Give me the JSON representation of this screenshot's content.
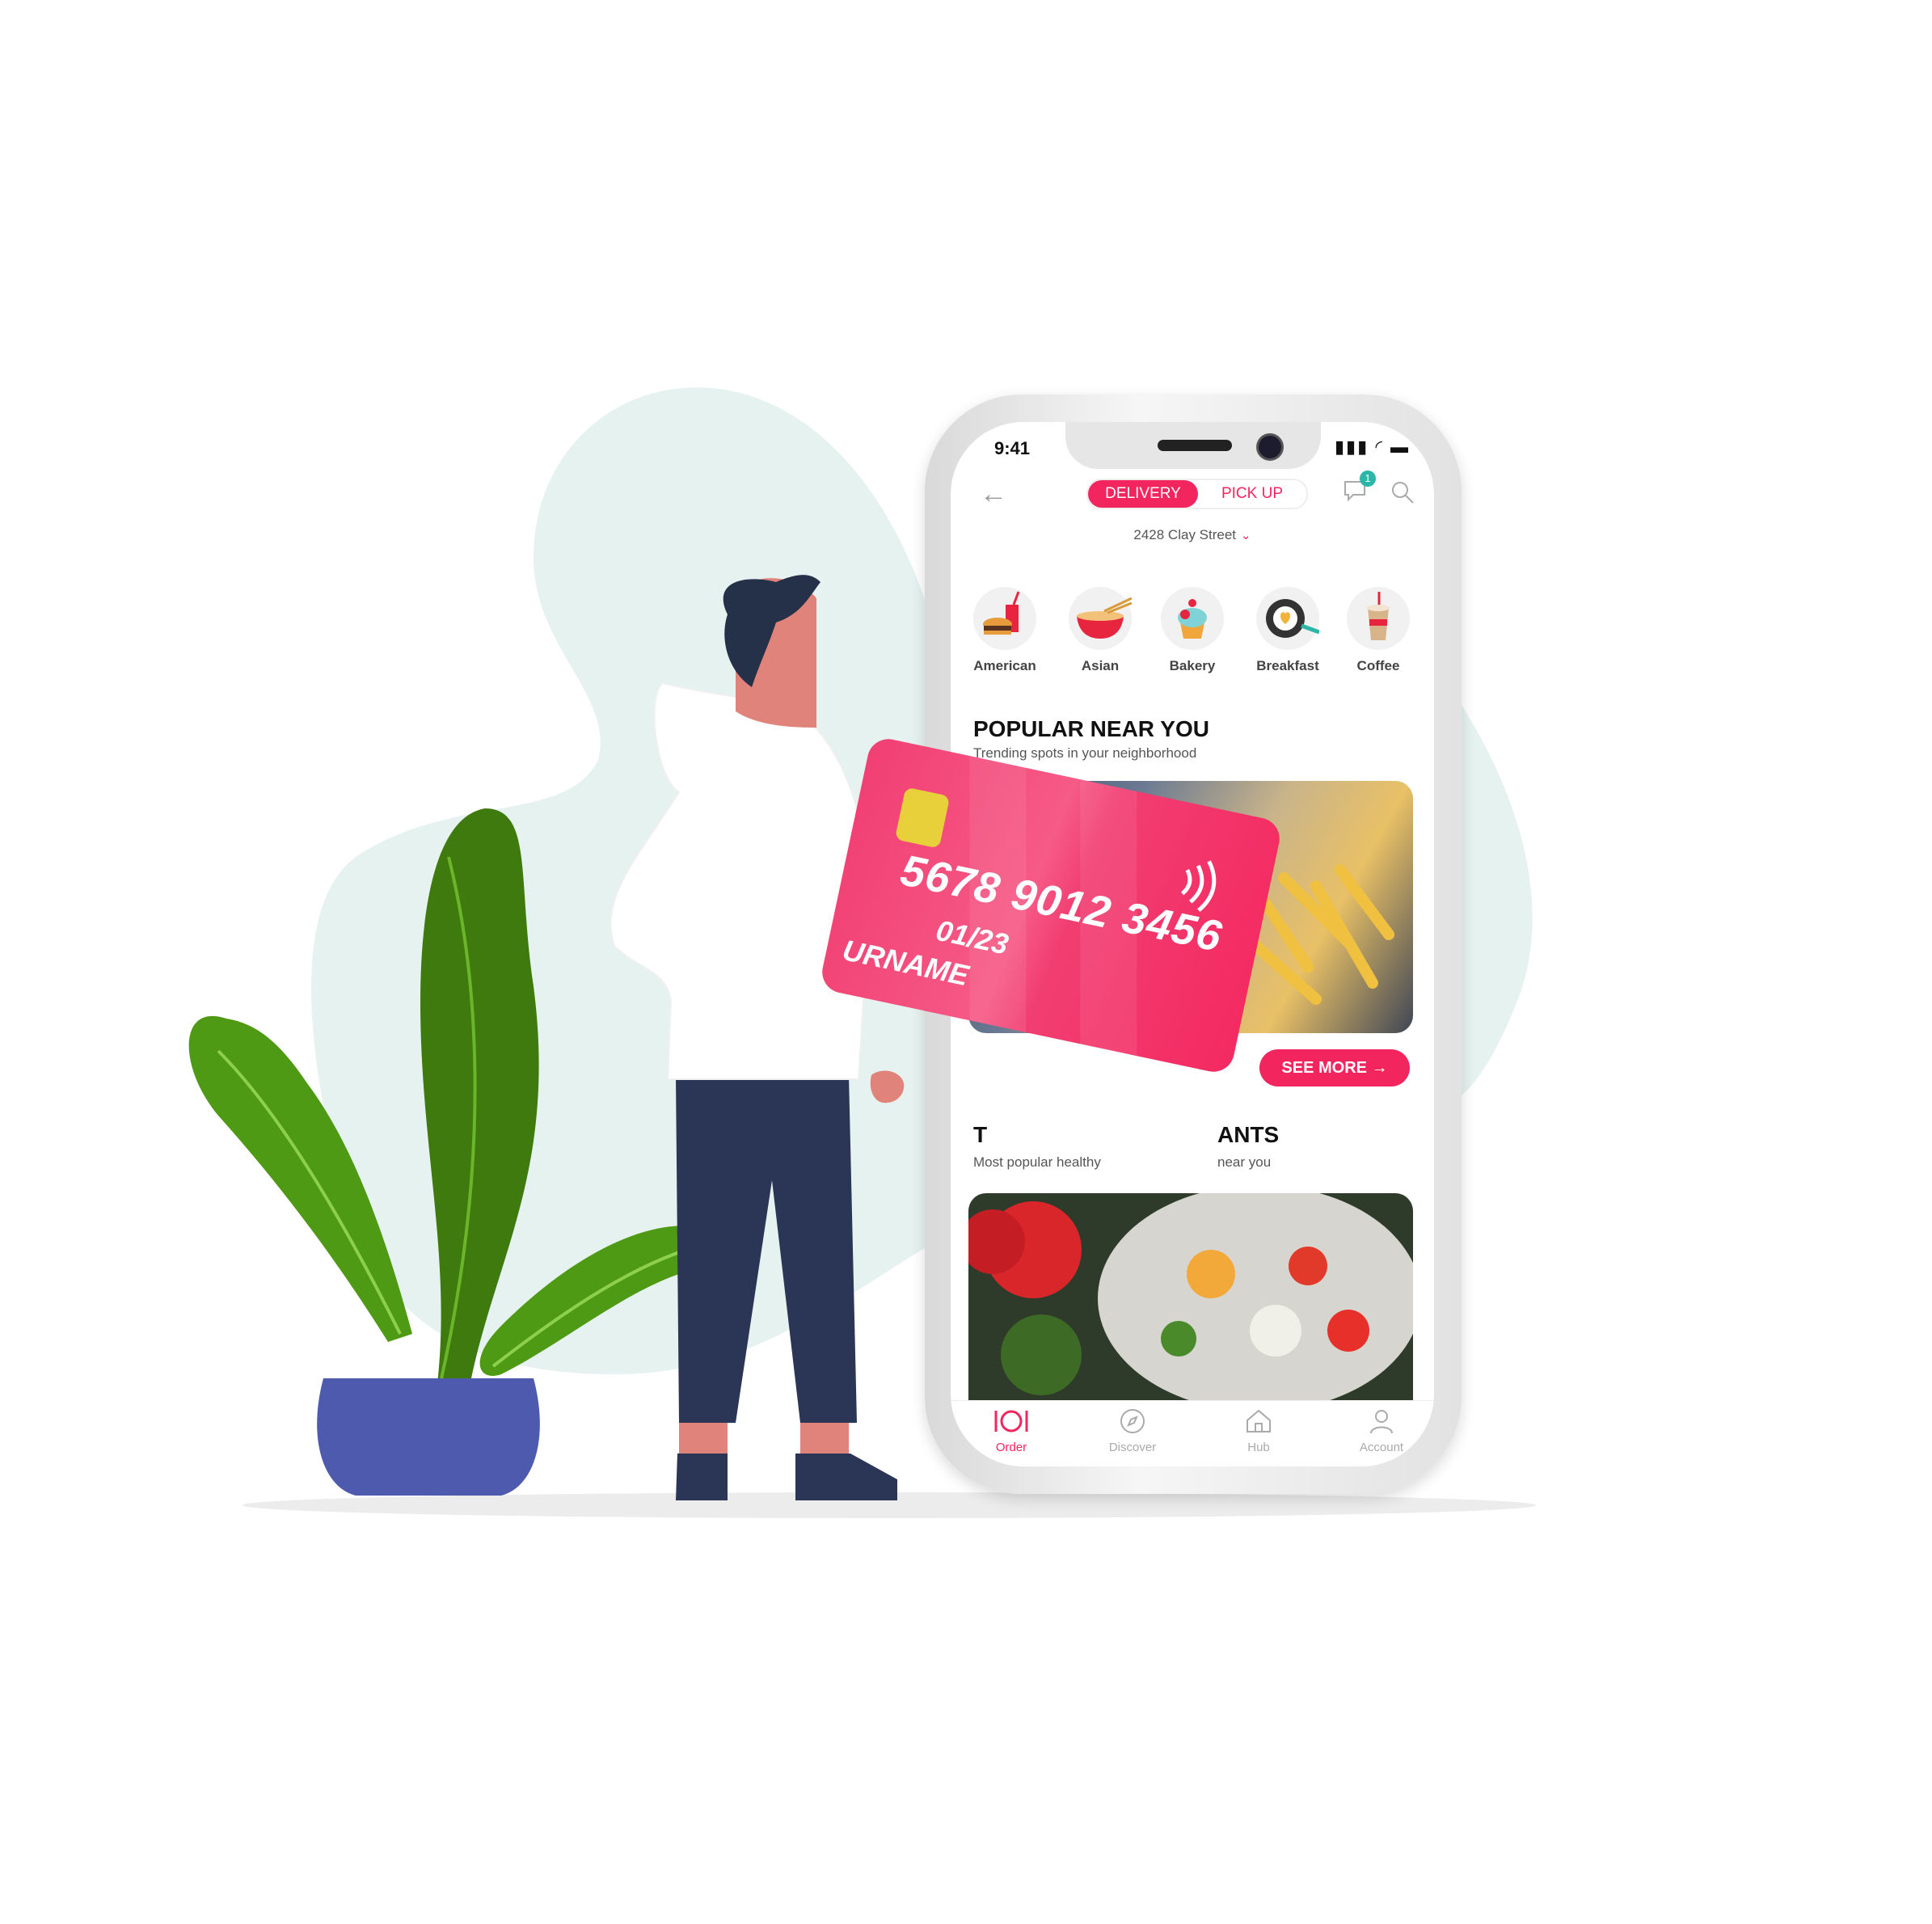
{
  "status_bar": {
    "time": "9:41",
    "icons": "▮▮▮ ◜ ▬"
  },
  "header": {
    "mode_selected": "DELIVERY",
    "mode_other": "PICK UP",
    "address": "2428 Clay Street",
    "notification_count": "1"
  },
  "categories": [
    {
      "label": "American",
      "icon": "burger-soda-icon"
    },
    {
      "label": "Asian",
      "icon": "noodle-bowl-icon"
    },
    {
      "label": "Bakery",
      "icon": "cupcake-icon"
    },
    {
      "label": "Breakfast",
      "icon": "fried-egg-pan-icon"
    },
    {
      "label": "Coffee",
      "icon": "iced-coffee-icon"
    }
  ],
  "popular": {
    "title": "POPULAR NEAR YOU",
    "subtitle": "Trending spots in your neighborhood",
    "see_more": "SEE MORE"
  },
  "top": {
    "title_left": "T",
    "title_right": "ANTS",
    "subtitle_left": "Most popular healthy",
    "subtitle_right": "near you"
  },
  "tabs": [
    {
      "label": "Order",
      "active": true
    },
    {
      "label": "Discover",
      "active": false
    },
    {
      "label": "Hub",
      "active": false
    },
    {
      "label": "Account",
      "active": false
    }
  ],
  "card": {
    "number": "5678 9012 3456",
    "expiry": "01/23",
    "name": "URNAME"
  },
  "colors": {
    "accent": "#f2255f",
    "teal": "#2cb6a8",
    "blob": "#e6f2ef",
    "plant_dark": "#3f7a0f",
    "plant_light": "#4f9a14",
    "pot": "#4e5aae",
    "pants": "#2b3555",
    "hair": "#253049",
    "skin": "#e0837a"
  }
}
